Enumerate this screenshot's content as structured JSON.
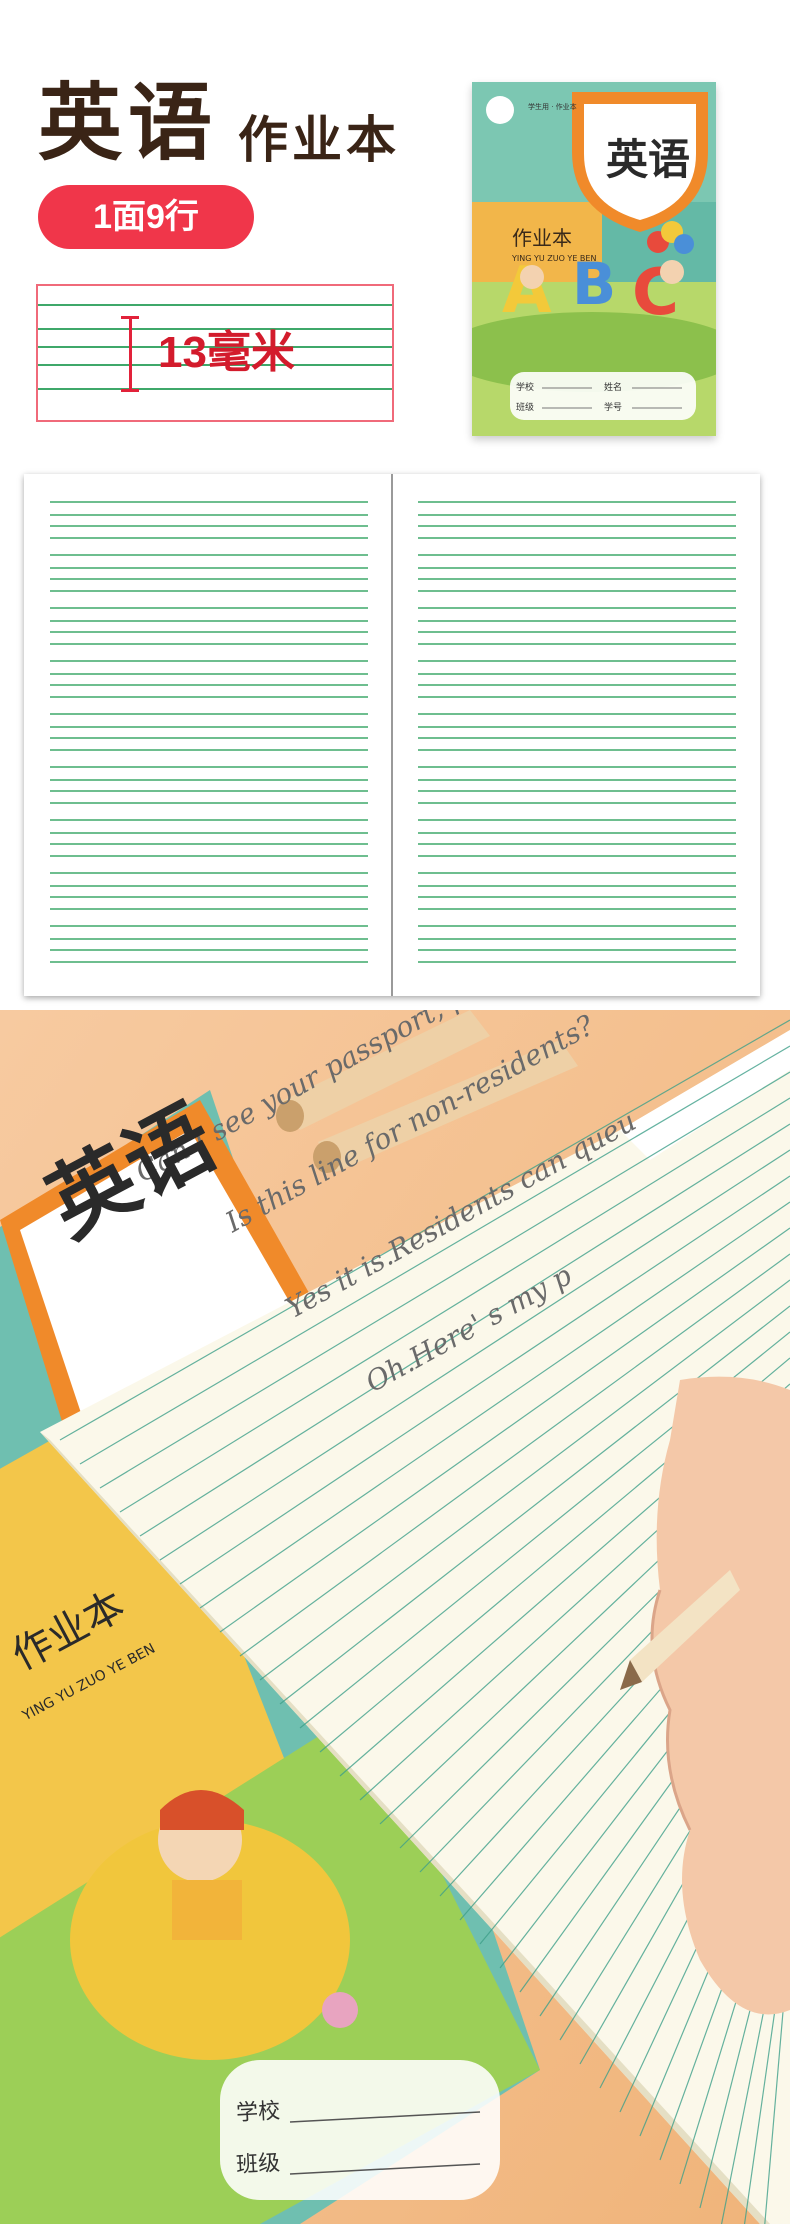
{
  "header": {
    "title_main": "英语",
    "title_sub": "作业本",
    "badge": "1面9行",
    "spacing_label": "13毫米"
  },
  "cover_small": {
    "title": "英语",
    "subtitle": "作业本",
    "pinyin": "YING YU ZUO YE BEN",
    "top_text": "学生用 · 作业本",
    "field_school": "学校",
    "field_name": "姓名",
    "field_class": "班级",
    "field_number": "学号"
  },
  "photo": {
    "cover_title": "英语",
    "cover_subtitle": "作业本",
    "cover_pinyin": "YING YU ZUO YE BEN",
    "field_school": "学校",
    "field_class": "班级",
    "handwriting": [
      "Can I see your passport, please?",
      "Is this line for non-residents?",
      "Yes it is.Residents can queu",
      "Oh.Here' s my p"
    ]
  },
  "colors": {
    "title_brown": "#3a2416",
    "badge_red": "#f0364a",
    "line_green": "#3fa86a",
    "background_peach": "#f5c28f",
    "cover_orange": "#f08a2a",
    "cover_teal": "#5cb6a4"
  }
}
